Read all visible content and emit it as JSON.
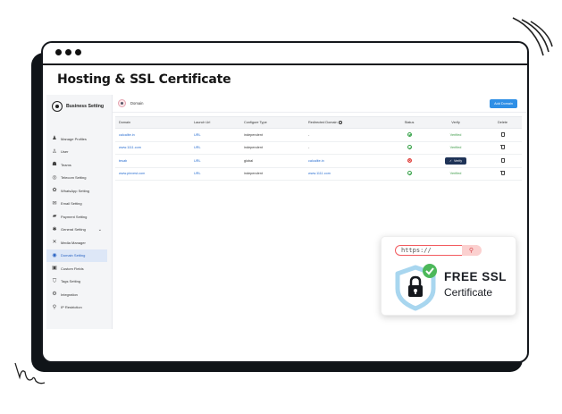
{
  "page": {
    "title": "Hosting & SSL Certificate"
  },
  "sidebar": {
    "brand": "Business Setting",
    "items": [
      {
        "label": "Manage Profiles",
        "icon": "person-icon",
        "glyph": "♟",
        "active": false,
        "caret": false
      },
      {
        "label": "User",
        "icon": "user-icon",
        "glyph": "♙",
        "active": false,
        "caret": false
      },
      {
        "label": "Teams",
        "icon": "teams-icon",
        "glyph": "☗",
        "active": false,
        "caret": false
      },
      {
        "label": "Telecom Setting",
        "icon": "telecom-icon",
        "glyph": "◎",
        "active": false,
        "caret": false
      },
      {
        "label": "WhatsApp Setting",
        "icon": "whatsapp-icon",
        "glyph": "✿",
        "active": false,
        "caret": false
      },
      {
        "label": "Email Setting",
        "icon": "email-icon",
        "glyph": "✉",
        "active": false,
        "caret": false
      },
      {
        "label": "Payment Setting",
        "icon": "payment-icon",
        "glyph": "▰",
        "active": false,
        "caret": false
      },
      {
        "label": "General Setting",
        "icon": "gear-icon",
        "glyph": "✱",
        "active": false,
        "caret": true
      },
      {
        "label": "Media Manager",
        "icon": "media-icon",
        "glyph": "✕",
        "active": false,
        "caret": false
      },
      {
        "label": "Domain Setting",
        "icon": "domain-icon",
        "glyph": "◉",
        "active": true,
        "caret": false
      },
      {
        "label": "Custom Fields",
        "icon": "custom-fields-icon",
        "glyph": "▣",
        "active": false,
        "caret": false
      },
      {
        "label": "Tags Setting",
        "icon": "tag-icon",
        "glyph": "⛉",
        "active": false,
        "caret": false
      },
      {
        "label": "Integration",
        "icon": "integration-icon",
        "glyph": "⚙",
        "active": false,
        "caret": false
      },
      {
        "label": "IP Restriction",
        "icon": "location-pin-icon",
        "glyph": "⚲",
        "active": false,
        "caret": false
      }
    ]
  },
  "domain_bar": {
    "label": "Domain",
    "add_button": "Add Domain"
  },
  "table": {
    "headers": [
      "Domain",
      "Launch Url",
      "Configure Type",
      "Redirected Domain",
      "Status",
      "Verify",
      "Delete"
    ],
    "rows": [
      {
        "domain": "calcalite.in",
        "launch": "URL",
        "type": "independent",
        "redirect": "-",
        "status": "ok",
        "verify": "Verified"
      },
      {
        "domain": "www.1111.com",
        "launch": "URL",
        "type": "independent",
        "redirect": "-",
        "status": "ok",
        "verify": "Verified"
      },
      {
        "domain": "tesab",
        "launch": "URL",
        "type": "global",
        "redirect": "calcalite.in",
        "status": "error",
        "verify": "Verify"
      },
      {
        "domain": "www.pinvest.com",
        "launch": "URL",
        "type": "independent",
        "redirect": "www.1111.com",
        "status": "ok",
        "verify": "Verified"
      }
    ]
  },
  "ssl_badge": {
    "url_text": "https://",
    "title": "FREE SSL",
    "subtitle": "Certificate"
  },
  "colors": {
    "accent": "#2f8fe6",
    "verify_button": "#1f3357",
    "status_ok": "#38a34a",
    "status_error": "#e0413d",
    "shield": "#a8d6ef",
    "check": "#4cb85a",
    "url_border": "#f25b5f"
  }
}
